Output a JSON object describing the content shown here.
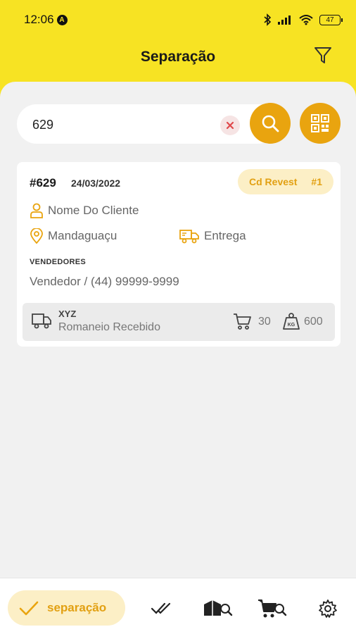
{
  "status_bar": {
    "time": "12:06",
    "notification_icon": "A",
    "battery": "47"
  },
  "app_bar": {
    "title": "Separação",
    "filter_icon": "filter-icon"
  },
  "search": {
    "value": "629",
    "clear_icon": "close-icon",
    "search_icon": "search-icon",
    "qr_icon": "qr-code-icon"
  },
  "order": {
    "number": "#629",
    "date": "24/03/2022",
    "badge_label": "Cd Revest",
    "badge_count": "#1",
    "client_name": "Nome Do Cliente",
    "city": "Mandaguaçu",
    "delivery_type": "Entrega",
    "sellers_label": "VENDEDORES",
    "seller": "Vendedor / (44) 99999-9999",
    "carrier": "XYZ",
    "romaneio_status": "Romaneio Recebido",
    "cart_qty": "30",
    "weight": "600",
    "weight_unit": "KG"
  },
  "bottom_nav": {
    "active_label": "separação",
    "items": [
      "done-check-icon",
      "box-search-icon",
      "cart-search-icon",
      "gear-icon"
    ]
  },
  "colors": {
    "brand_yellow": "#f7e323",
    "accent_orange": "#e9a40f",
    "badge_bg": "#fcefc6"
  }
}
